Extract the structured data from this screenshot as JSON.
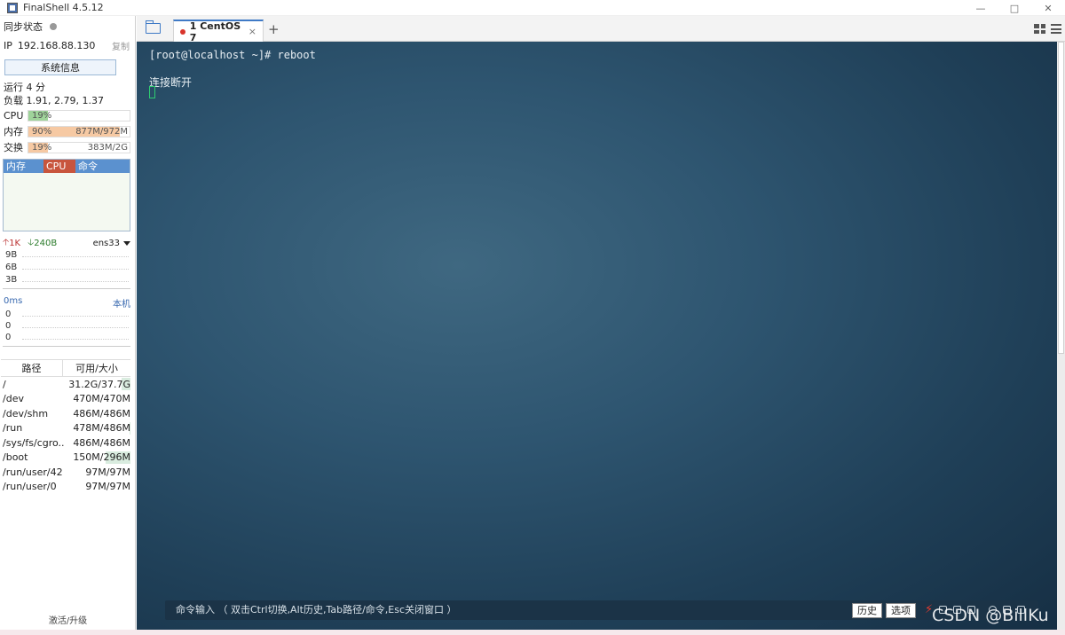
{
  "window": {
    "title": "FinalShell 4.5.12",
    "controls": [
      "minimize-icon",
      "maximize-icon",
      "close-icon"
    ]
  },
  "sidebar": {
    "sync_label": "同步状态",
    "ip_label": "IP",
    "ip_value": "192.168.88.130",
    "copy_label": "复制",
    "sysinfo_button": "系统信息",
    "uptime": "运行 4 分",
    "load": "负载 1.91, 2.79, 1.37",
    "cpu": {
      "label": "CPU",
      "percent": "19%",
      "fraction": 0.19,
      "color": "#9fd39a"
    },
    "memory": {
      "label": "内存",
      "percent": "90%",
      "value": "877M/972M",
      "fraction": 0.9,
      "color": "#f6c9a3"
    },
    "swap": {
      "label": "交换",
      "percent": "19%",
      "value": "383M/2G",
      "fraction": 0.19,
      "color": "#f6c9a3"
    },
    "process_table": {
      "columns": [
        {
          "label": "内存",
          "color": "#5b91cf"
        },
        {
          "label": "CPU",
          "color": "#c8553d"
        },
        {
          "label": "命令",
          "color": "#5b91cf"
        }
      ]
    },
    "network": {
      "up": "1K",
      "down": "240B",
      "interface": "ens33",
      "y_ticks": [
        "9B",
        "6B",
        "3B"
      ]
    },
    "ping": {
      "latency": "0ms",
      "target": "本机",
      "y_ticks": [
        "0",
        "0",
        "0"
      ]
    },
    "disk": {
      "columns": [
        "路径",
        "可用/大小"
      ],
      "rows": [
        {
          "path": "/",
          "size": "31.2G/37.7G",
          "used": 0.17
        },
        {
          "path": "/dev",
          "size": "470M/470M",
          "used": 0.0
        },
        {
          "path": "/dev/shm",
          "size": "486M/486M",
          "used": 0.0
        },
        {
          "path": "/run",
          "size": "478M/486M",
          "used": 0.02
        },
        {
          "path": "/sys/fs/cgro...",
          "size": "486M/486M",
          "used": 0.0
        },
        {
          "path": "/boot",
          "size": "150M/296M",
          "used": 0.49
        },
        {
          "path": "/run/user/42",
          "size": "97M/97M",
          "used": 0.0
        },
        {
          "path": "/run/user/0",
          "size": "97M/97M",
          "used": 0.0
        }
      ]
    },
    "activate_label": "激活/升级"
  },
  "tabs": {
    "items": [
      {
        "label": "1 CentOS 7",
        "status_color": "#d9342b"
      }
    ],
    "close": "×",
    "add": "+"
  },
  "terminal": {
    "lines": [
      "[root@localhost ~]# reboot",
      "连接断开"
    ]
  },
  "command_bar": {
    "hint": "命令输入 （ 双击Ctrl切换,Alt历史,Tab路径/命令,Esc关闭窗口 ）",
    "history_button": "历史",
    "options_button": "选项"
  },
  "watermark": "CSDN @BillKu"
}
